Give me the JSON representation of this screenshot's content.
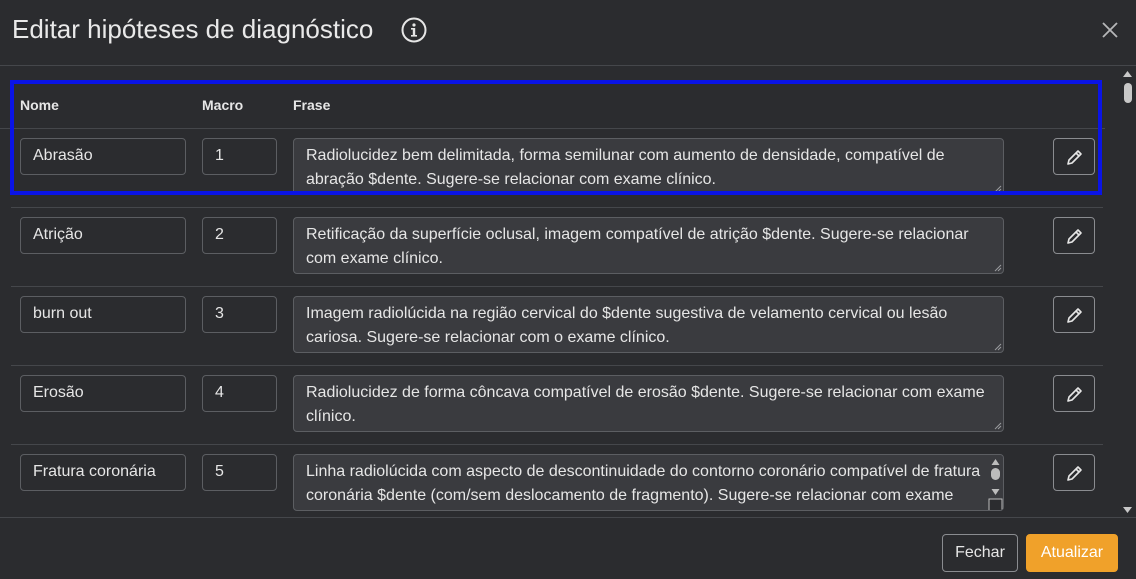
{
  "modal": {
    "title": "Editar hipóteses de diagnóstico",
    "info_icon": "info-circle-icon",
    "close_icon": "close-icon"
  },
  "table": {
    "headers": {
      "name": "Nome",
      "macro": "Macro",
      "phrase": "Frase"
    },
    "rows": [
      {
        "name": "Abrasão",
        "macro": "1",
        "phrase": "Radiolucidez bem delimitada, forma semilunar com aumento de densidade, compatível de abração $dente. Sugere-se relacionar com exame clínico."
      },
      {
        "name": "Atrição",
        "macro": "2",
        "phrase": "Retificação da superfície oclusal, imagem compatível de atrição $dente. Sugere-se relacionar com exame clínico."
      },
      {
        "name": "burn out",
        "macro": "3",
        "phrase": "Imagem radiolúcida na região cervical do $dente sugestiva de velamento cervical ou lesão cariosa. Sugere-se relacionar com o exame clínico."
      },
      {
        "name": "Erosão",
        "macro": "4",
        "phrase": "Radiolucidez de forma côncava compatível de erosão $dente. Sugere-se relacionar com exame clínico."
      },
      {
        "name": "Fratura coronária",
        "macro": "5",
        "phrase": "Linha radiolúcida com aspecto de descontinuidade do contorno coronário compatível de fratura coronária $dente (com/sem deslocamento de fragmento). Sugere-se relacionar com exame clínico."
      }
    ],
    "edit_icon": "pencil-icon"
  },
  "footer": {
    "close_label": "Fechar",
    "update_label": "Atualizar"
  },
  "colors": {
    "background": "#2b2c2f",
    "accent": "#f0a12a",
    "highlight": "#0a14e6"
  }
}
